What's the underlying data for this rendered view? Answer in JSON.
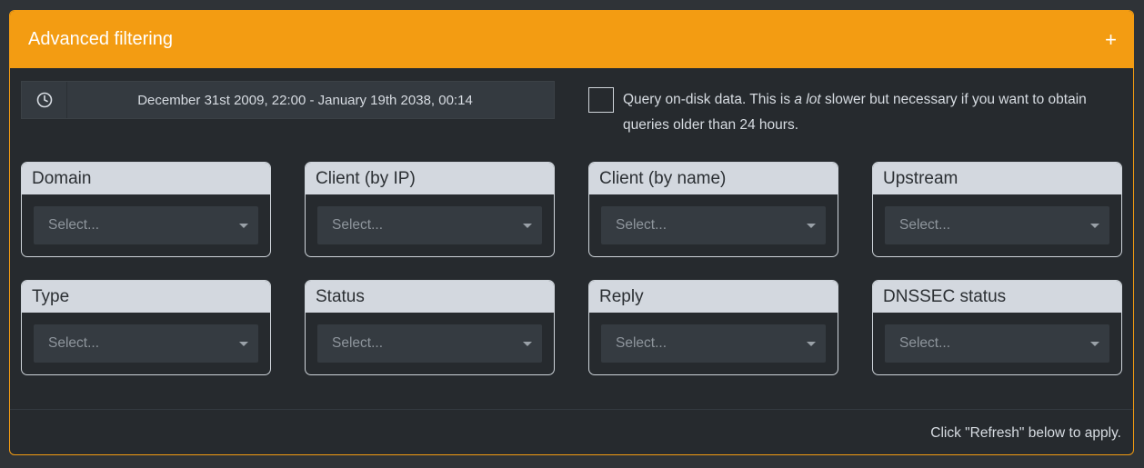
{
  "panel": {
    "title": "Advanced filtering",
    "expand_icon": "plus-icon",
    "accent_color": "#f39c12"
  },
  "daterange": {
    "icon": "clock-icon",
    "value": "December 31st 2009, 22:00 - January 19th 2038, 00:14"
  },
  "ondisk": {
    "checked": false,
    "text_before": "Query on-disk data. This is ",
    "text_emphasis": "a lot",
    "text_after": " slower but necessary if you want to obtain",
    "text_line2": "queries older than 24 hours."
  },
  "filters": [
    {
      "label": "Domain",
      "placeholder": "Select..."
    },
    {
      "label": "Client (by IP)",
      "placeholder": "Select..."
    },
    {
      "label": "Client (by name)",
      "placeholder": "Select..."
    },
    {
      "label": "Upstream",
      "placeholder": "Select..."
    },
    {
      "label": "Type",
      "placeholder": "Select..."
    },
    {
      "label": "Status",
      "placeholder": "Select..."
    },
    {
      "label": "Reply",
      "placeholder": "Select..."
    },
    {
      "label": "DNSSEC status",
      "placeholder": "Select..."
    }
  ],
  "footer": {
    "note": "Click \"Refresh\" below to apply."
  }
}
